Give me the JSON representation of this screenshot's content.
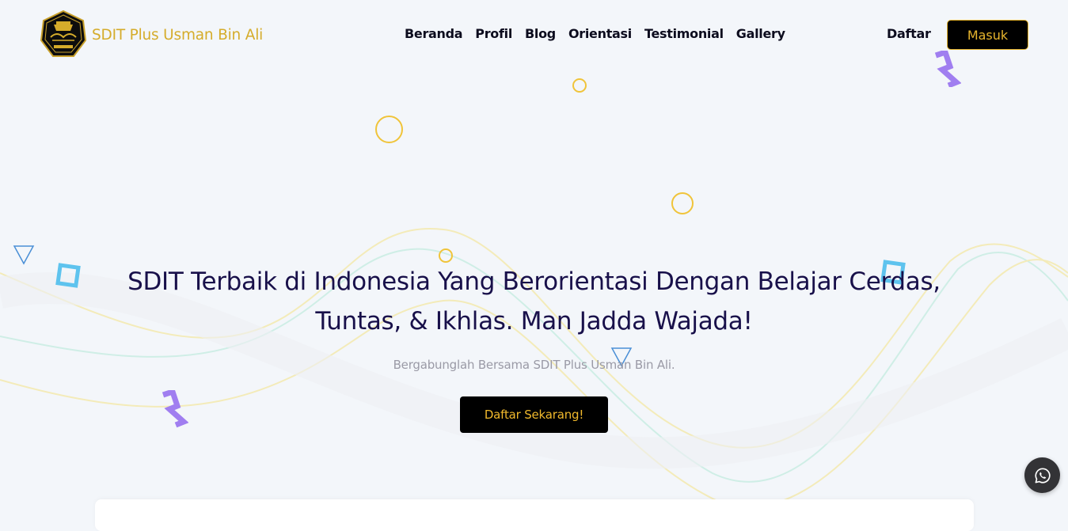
{
  "header": {
    "brand_name": "SDIT Plus Usman Bin Ali",
    "logo_icon": "school-crest-logo",
    "nav": [
      {
        "label": "Beranda"
      },
      {
        "label": "Profil"
      },
      {
        "label": "Blog"
      },
      {
        "label": "Orientasi"
      },
      {
        "label": "Testimonial"
      },
      {
        "label": "Gallery"
      }
    ],
    "register_label": "Daftar",
    "login_label": "Masuk"
  },
  "hero": {
    "title_line1": "SDIT Terbaik di Indonesia Yang Berorientasi Dengan Belajar Cerdas,",
    "title_line2": "Tuntas, & Ikhlas. Man Jadda Wajada!",
    "subtitle": "Bergabunglah Bersama SDIT Plus Usman Bin Ali.",
    "cta_label": "Daftar Sekarang!"
  },
  "floating": {
    "whatsapp_icon": "whatsapp-icon"
  },
  "colors": {
    "brand_gold": "#d5ac2b",
    "button_gold": "#f1b92c",
    "title_navy": "#18104a",
    "background": "#f3f6fa",
    "accent_purple": "#a07ef0",
    "accent_blue": "#5ec3ee"
  }
}
